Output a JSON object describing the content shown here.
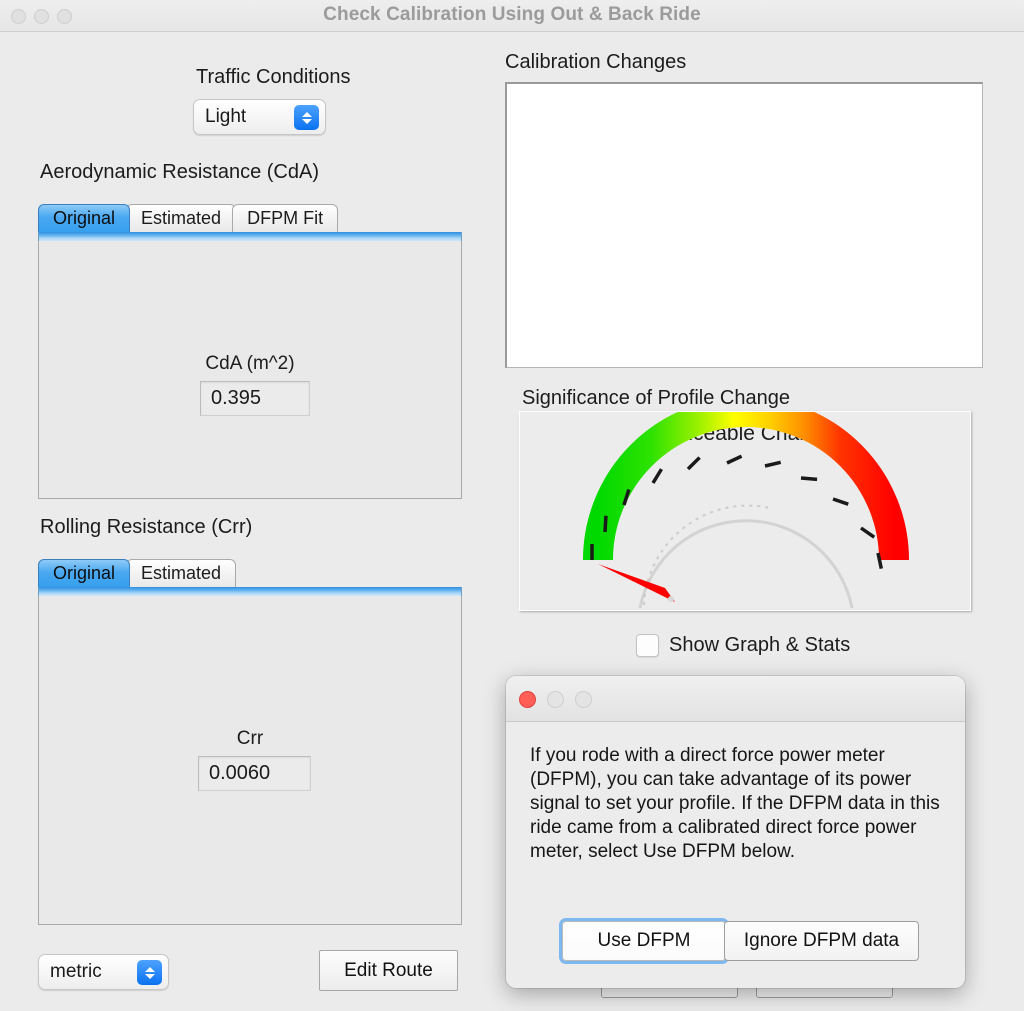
{
  "window": {
    "title": "Check Calibration Using Out & Back Ride",
    "traffic_lights": [
      "close-inactive",
      "minimize-inactive",
      "zoom-inactive"
    ]
  },
  "left": {
    "traffic_conditions": {
      "title": "Traffic Conditions",
      "value": "Light"
    },
    "aero": {
      "title": "Aerodynamic Resistance (CdA)",
      "tabs": [
        {
          "label": "Original",
          "active": true
        },
        {
          "label": "Estimated",
          "active": false
        },
        {
          "label": "DFPM Fit",
          "active": false
        }
      ],
      "field_label": "CdA (m^2)",
      "field_value": "0.395"
    },
    "rolling": {
      "title": "Rolling Resistance (Crr)",
      "tabs": [
        {
          "label": "Original",
          "active": true
        },
        {
          "label": "Estimated",
          "active": false
        }
      ],
      "field_label": "Crr",
      "field_value": "0.0060"
    },
    "units": {
      "value": "metric"
    },
    "edit_route_label": "Edit Route"
  },
  "right": {
    "calibration_changes": {
      "title": "Calibration Changes",
      "content": ""
    },
    "significance": {
      "title": "Significance of Profile Change",
      "caption": "Noticeable Change"
    },
    "show_graph_stats": {
      "label": "Show Graph & Stats",
      "checked": false
    }
  },
  "dialog": {
    "title_buttons": [
      "close",
      "minimize",
      "zoom"
    ],
    "body": "If you rode with a direct force power meter (DFPM), you can take advantage of its power signal to set your profile.  If the DFPM data in this ride came from a calibrated direct force power meter, select Use DFPM below.",
    "primary_button": "Use DFPM",
    "secondary_button": "Ignore DFPM data"
  },
  "chart_data": {
    "type": "gauge",
    "title": "Significance of Profile Change",
    "caption": "Noticeable Change",
    "needle_value": 0,
    "range": [
      0,
      10
    ],
    "tick_count": 11,
    "arc_start_angle_deg": 198,
    "arc_end_angle_deg": 342,
    "colors": {
      "low": "#00e000",
      "mid": "#ffff00",
      "high": "#ff0000"
    },
    "zones": [
      {
        "label": "low",
        "color": "#00e000"
      },
      {
        "label": "medium",
        "color": "#b5f000"
      },
      {
        "label": "caution",
        "color": "#ffff00"
      },
      {
        "label": "warning",
        "color": "#ffa000"
      },
      {
        "label": "high",
        "color": "#ff0000"
      }
    ]
  }
}
